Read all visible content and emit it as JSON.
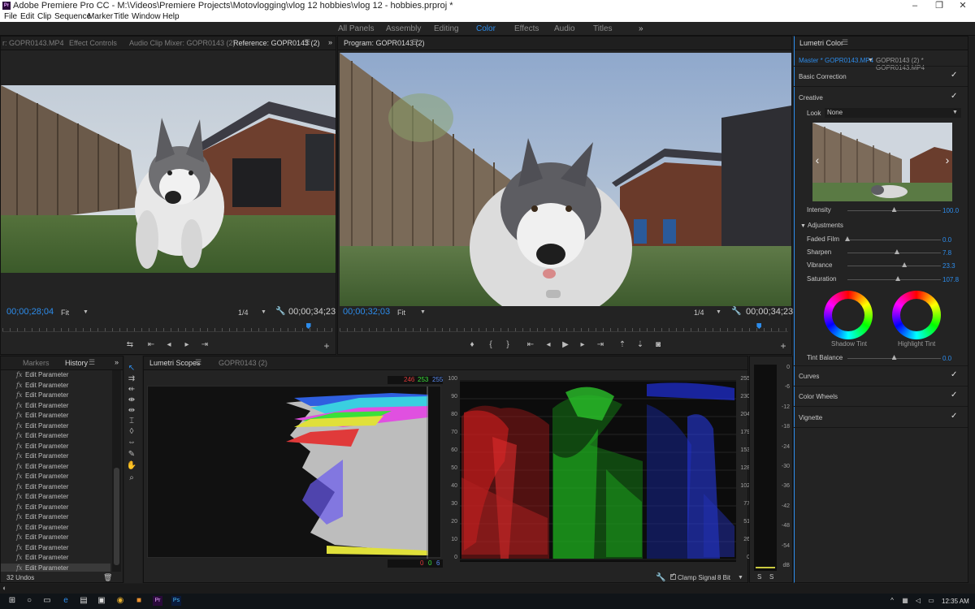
{
  "app": {
    "title": "Adobe Premiere Pro CC - M:\\Videos\\Premiere Projects\\Motovlogging\\vlog 12 hobbies\\vlog 12 - hobbies.prproj *",
    "logo": "Pr"
  },
  "menu": [
    "File",
    "Edit",
    "Clip",
    "Sequence",
    "Marker",
    "Title",
    "Window",
    "Help"
  ],
  "workspaces": {
    "items": [
      "All Panels",
      "Assembly",
      "Editing",
      "Color",
      "Effects",
      "Audio",
      "Titles"
    ],
    "active": "Color",
    "overflow": "»"
  },
  "source_panel": {
    "tabs": [
      "r: GOPR0143.MP4",
      "Effect Controls",
      "Audio Clip Mixer: GOPR0143 (2)",
      "Reference: GOPR0143 (2)"
    ],
    "active_tab": "Reference: GOPR0143 (2)",
    "timecode_left": "00;00;28;04",
    "fit": "Fit",
    "resolution": "1/4",
    "timecode_right": "00;00;34;23",
    "playhead": 0.92
  },
  "program_panel": {
    "tab": "Program: GOPR0143 (2)",
    "timecode_left": "00;00;32;03",
    "fit": "Fit",
    "resolution": "1/4",
    "timecode_right": "00;00;34;23",
    "playhead": 0.93
  },
  "history_panel": {
    "tabs": [
      "Markers",
      "History"
    ],
    "active_tab": "History",
    "items": [
      "Edit Parameter",
      "Edit Parameter",
      "Edit Parameter",
      "Edit Parameter",
      "Edit Parameter",
      "Edit Parameter",
      "Edit Parameter",
      "Edit Parameter",
      "Edit Parameter",
      "Edit Parameter",
      "Edit Parameter",
      "Edit Parameter",
      "Edit Parameter",
      "Edit Parameter",
      "Edit Parameter",
      "Edit Parameter",
      "Edit Parameter",
      "Edit Parameter",
      "Edit Parameter",
      "Edit Parameter"
    ],
    "fx_glyph": "fx",
    "undo_count": "32 Undos"
  },
  "scopes_panel": {
    "tabs": [
      "Lumetri Scopes",
      "GOPR0143 (2)"
    ],
    "active_tab": "Lumetri Scopes",
    "rgb_top": {
      "r": "246",
      "g": "253",
      "b": "255"
    },
    "rgb_bottom": {
      "r": "0",
      "g": "0",
      "b": "6"
    },
    "parade_left_scale": [
      "100",
      "90",
      "80",
      "70",
      "60",
      "50",
      "40",
      "30",
      "20",
      "10",
      "0"
    ],
    "parade_right_scale": [
      "255",
      "230",
      "204",
      "179",
      "153",
      "128",
      "102",
      "77",
      "51",
      "26",
      "0"
    ],
    "clamp_signal": "Clamp Signal",
    "bit_depth": "8 Bit"
  },
  "audio_meter": {
    "scale": [
      "0",
      "-6",
      "-12",
      "-18",
      "-24",
      "-30",
      "-36",
      "-42",
      "-48",
      "-54",
      "dB"
    ],
    "solo_left": "S",
    "solo_right": "S"
  },
  "lumetri_color": {
    "title": "Lumetri Color",
    "master": "Master * GOPR0143.MP4",
    "clip": "GOPR0143 (2) * GOPR0143.MP4",
    "sections": {
      "basic": "Basic Correction",
      "creative": "Creative",
      "curves": "Curves",
      "color_wheels": "Color Wheels",
      "vignette": "Vignette"
    },
    "look_label": "Look",
    "look_value": "None",
    "intensity_label": "Intensity",
    "intensity_value": "100.0",
    "intensity": 0.5,
    "adjustments": "Adjustments",
    "faded_film_label": "Faded Film",
    "faded_film_value": "0.0",
    "faded_film": 0.0,
    "sharpen_label": "Sharpen",
    "sharpen_value": "7.8",
    "sharpen": 0.53,
    "vibrance_label": "Vibrance",
    "vibrance_value": "23.3",
    "vibrance": 0.61,
    "saturation_label": "Saturation",
    "saturation_value": "107.8",
    "saturation": 0.54,
    "shadow_tint": "Shadow Tint",
    "highlight_tint": "Highlight Tint",
    "tint_balance_label": "Tint Balance",
    "tint_balance_value": "0.0",
    "tint_balance": 0.5,
    "check": "✓"
  },
  "taskbar": {
    "time": "12:35 AM"
  },
  "colors": {
    "accent": "#2d8ceb",
    "panel_bg": "#232323",
    "red": "#e03a3a",
    "green": "#3ae03a",
    "blue": "#3a6ae0"
  }
}
